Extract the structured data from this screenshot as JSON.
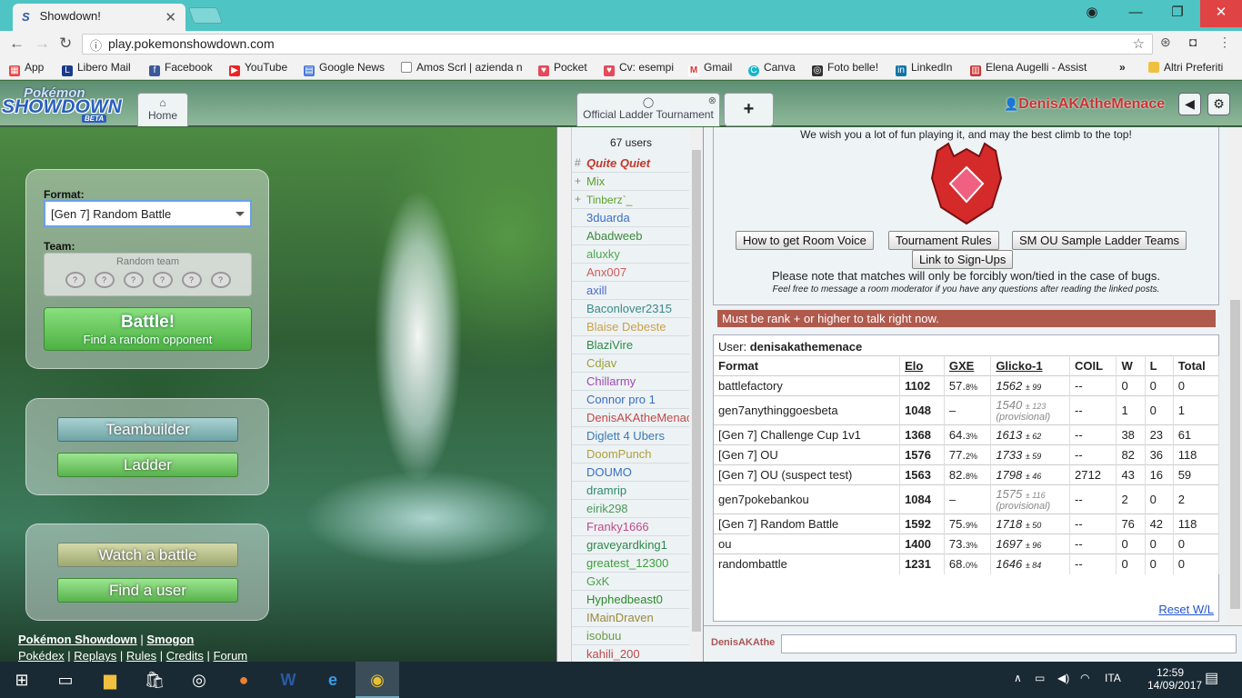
{
  "browser": {
    "tab_title": "Showdown!",
    "url": "play.pokemonshowdown.com",
    "bookmarks": [
      "App",
      "Libero Mail",
      "Facebook",
      "YouTube",
      "Google News",
      "Amos Scrl | azienda n",
      "Pocket",
      "Cv: esempi",
      "Gmail",
      "Canva",
      "Foto belle!",
      "LinkedIn",
      "Elena Augelli - Assist"
    ],
    "bookmarks_more": "»",
    "other_bookmarks": "Altri Preferiti"
  },
  "header": {
    "logo_top": "Pokémon",
    "logo_main": "SHOWDOWN",
    "logo_beta": "BETA",
    "home_tab": "Home",
    "room_tab": "Official Ladder Tournament",
    "plus_tab": "+",
    "username": "DenisAKAtheMenace"
  },
  "left": {
    "format_label": "Format:",
    "format_value": "[Gen 7] Random Battle",
    "team_label": "Team:",
    "team_value": "Random team",
    "battle_title": "Battle!",
    "battle_sub": "Find a random opponent",
    "teambuilder": "Teambuilder",
    "ladder": "Ladder",
    "watch": "Watch a battle",
    "find_user": "Find a user",
    "footer1": [
      "Pokémon Showdown",
      "|",
      "Smogon"
    ],
    "footer2": [
      "Pokédex",
      "|",
      "Replays",
      "|",
      "Rules",
      "|",
      "Credits",
      "|",
      "Forum"
    ]
  },
  "userlist": {
    "count": "67 users",
    "users": [
      {
        "rank": "#",
        "name": "Quite Quiet",
        "color": "#c0392b",
        "style": "bi"
      },
      {
        "rank": "+",
        "name": "Mix",
        "color": "#5aa02c",
        "style": ""
      },
      {
        "rank": "+",
        "name": "Tinberz`_",
        "color": "#5aa02c",
        "style": "sm"
      },
      {
        "rank": "",
        "name": "3duarda",
        "color": "#3a6fc4",
        "style": ""
      },
      {
        "rank": "",
        "name": "Abadweeb",
        "color": "#3b8a3b",
        "style": ""
      },
      {
        "rank": "",
        "name": "aluxky",
        "color": "#4ea84e",
        "style": ""
      },
      {
        "rank": "",
        "name": "Anx007",
        "color": "#d05a5a",
        "style": ""
      },
      {
        "rank": "",
        "name": "axill",
        "color": "#4a6ad0",
        "style": ""
      },
      {
        "rank": "",
        "name": "Baconlover2315",
        "color": "#3a8a8a",
        "style": ""
      },
      {
        "rank": "",
        "name": "Blaise Debeste",
        "color": "#c9a24a",
        "style": ""
      },
      {
        "rank": "",
        "name": "BlaziVire",
        "color": "#2d8a4a",
        "style": ""
      },
      {
        "rank": "",
        "name": "Cdjav",
        "color": "#9aa03a",
        "style": ""
      },
      {
        "rank": "",
        "name": "Chillarmy",
        "color": "#a04ab0",
        "style": ""
      },
      {
        "rank": "",
        "name": "Connor pro 1",
        "color": "#3a6fc4",
        "style": ""
      },
      {
        "rank": "",
        "name": "DenisAKAtheMenace",
        "color": "#c04a4a",
        "style": ""
      },
      {
        "rank": "",
        "name": "Diglett 4 Ubers",
        "color": "#3a7ab4",
        "style": ""
      },
      {
        "rank": "",
        "name": "DoomPunch",
        "color": "#b0a03a",
        "style": ""
      },
      {
        "rank": "",
        "name": "DOUMO",
        "color": "#3a6fc4",
        "style": ""
      },
      {
        "rank": "",
        "name": "dramrip",
        "color": "#2d8a6a",
        "style": ""
      },
      {
        "rank": "",
        "name": "eirik298",
        "color": "#4a9a5a",
        "style": ""
      },
      {
        "rank": "",
        "name": "Franky1666",
        "color": "#c04a8a",
        "style": ""
      },
      {
        "rank": "",
        "name": "graveyardking1",
        "color": "#2d8a4a",
        "style": ""
      },
      {
        "rank": "",
        "name": "greatest_12300",
        "color": "#3aa03a",
        "style": ""
      },
      {
        "rank": "",
        "name": "GxK",
        "color": "#4aa04a",
        "style": ""
      },
      {
        "rank": "",
        "name": "Hyphedbeast0",
        "color": "#2d8a2d",
        "style": ""
      },
      {
        "rank": "",
        "name": "IMainDraven",
        "color": "#9a8a3a",
        "style": ""
      },
      {
        "rank": "",
        "name": "isobuu",
        "color": "#6a9a4a",
        "style": ""
      },
      {
        "rank": "",
        "name": "kahili_200",
        "color": "#c04a4a",
        "style": ""
      }
    ]
  },
  "room": {
    "wish_text": "We wish you a lot of fun playing it, and may the best climb to the top!",
    "buttons": [
      "How to get Room Voice",
      "Tournament Rules",
      "SM OU Sample Ladder Teams",
      "Link to Sign-Ups"
    ],
    "note": "Please note that matches will only be forcibly won/tied in the case of bugs.",
    "note2": "Feel free to message a room moderator if you have any questions after reading the linked posts.",
    "mustbe": "Must be rank + or higher to talk right now.",
    "user_label": "User:",
    "user_value": "denisakathemenace",
    "reset": "Reset W/L",
    "chat_name": "DenisAKAthe"
  },
  "ladder_table": {
    "headers": [
      "Format",
      "Elo",
      "GXE",
      "Glicko-1",
      "COIL",
      "W",
      "L",
      "Total"
    ],
    "rows": [
      {
        "format": "battlefactory",
        "elo": "1102",
        "gxe": "57.",
        "gxe_d": "8%",
        "glicko": "1562",
        "dev": "± 99",
        "prov": "",
        "coil": "--",
        "w": "0",
        "l": "0",
        "t": "0"
      },
      {
        "format": "gen7anythinggoesbeta",
        "elo": "1048",
        "gxe": "–",
        "gxe_d": "",
        "glicko": "1540",
        "dev": "± 123",
        "prov": "(provisional)",
        "coil": "--",
        "w": "1",
        "l": "0",
        "t": "1"
      },
      {
        "format": "[Gen 7] Challenge Cup 1v1",
        "elo": "1368",
        "gxe": "64.",
        "gxe_d": "3%",
        "glicko": "1613",
        "dev": "± 62",
        "prov": "",
        "coil": "--",
        "w": "38",
        "l": "23",
        "t": "61"
      },
      {
        "format": "[Gen 7] OU",
        "elo": "1576",
        "gxe": "77.",
        "gxe_d": "2%",
        "glicko": "1733",
        "dev": "± 59",
        "prov": "",
        "coil": "--",
        "w": "82",
        "l": "36",
        "t": "118"
      },
      {
        "format": "[Gen 7] OU (suspect test)",
        "elo": "1563",
        "gxe": "82.",
        "gxe_d": "8%",
        "glicko": "1798",
        "dev": "± 46",
        "prov": "",
        "coil": "2712",
        "w": "43",
        "l": "16",
        "t": "59"
      },
      {
        "format": "gen7pokebankou",
        "elo": "1084",
        "gxe": "–",
        "gxe_d": "",
        "glicko": "1575",
        "dev": "± 116",
        "prov": "(provisional)",
        "coil": "--",
        "w": "2",
        "l": "0",
        "t": "2"
      },
      {
        "format": "[Gen 7] Random Battle",
        "elo": "1592",
        "gxe": "75.",
        "gxe_d": "9%",
        "glicko": "1718",
        "dev": "± 50",
        "prov": "",
        "coil": "--",
        "w": "76",
        "l": "42",
        "t": "118"
      },
      {
        "format": "ou",
        "elo": "1400",
        "gxe": "73.",
        "gxe_d": "3%",
        "glicko": "1697",
        "dev": "± 96",
        "prov": "",
        "coil": "--",
        "w": "0",
        "l": "0",
        "t": "0"
      },
      {
        "format": "randombattle",
        "elo": "1231",
        "gxe": "68.",
        "gxe_d": "0%",
        "glicko": "1646",
        "dev": "± 84",
        "prov": "",
        "coil": "--",
        "w": "0",
        "l": "0",
        "t": "0"
      }
    ]
  },
  "taskbar": {
    "lang": "ITA",
    "time": "12:59",
    "date": "14/09/2017"
  }
}
